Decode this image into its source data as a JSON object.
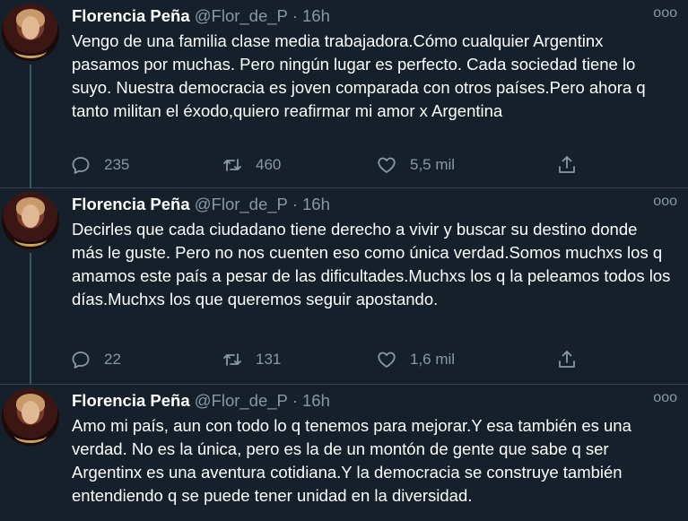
{
  "tweets": [
    {
      "name": "Florencia Peña",
      "handle": "@Flor_de_P · 16h",
      "more": "ooo",
      "text": "Vengo de una familia clase media trabajadora.Cómo cualquier Argentinx pasamos por muchas. Pero ningún lugar es perfecto. Cada sociedad tiene lo suyo. Nuestra democracia es joven comparada con otros países.Pero ahora q tanto militan el éxodo,quiero reafirmar mi amor x Argentina",
      "replies": "235",
      "retweets": "460",
      "likes": "5,5 mil"
    },
    {
      "name": "Florencia Peña",
      "handle": "@Flor_de_P · 16h",
      "more": "ooo",
      "text": "Decirles que cada ciudadano tiene derecho a vivir y buscar su destino donde más le guste. Pero no nos cuenten eso como única verdad.Somos muchxs los q amamos este país a pesar de las dificultades.Muchxs los q la peleamos todos los días.Muchxs los que queremos seguir apostando.",
      "replies": "22",
      "retweets": "131",
      "likes": "1,6 mil"
    },
    {
      "name": "Florencia Peña",
      "handle": "@Flor_de_P · 16h",
      "more": "ooo",
      "text": "Amo mi país, aun con todo lo q tenemos para mejorar.Y esa también es una verdad. No es la única, pero es la de un montón de gente que sabe q ser Argentinx es una aventura cotidiana.Y la democracia se construye también entendiendo q se puede tener unidad en la diversidad."
    }
  ],
  "icons": {
    "reply": "reply-icon",
    "retweet": "retweet-icon",
    "like": "heart-icon",
    "share": "share-icon",
    "more": "more-icon"
  },
  "colors": {
    "background": "#15202b",
    "text": "#ffffff",
    "secondary": "#8899a6",
    "divider": "#38444d"
  }
}
